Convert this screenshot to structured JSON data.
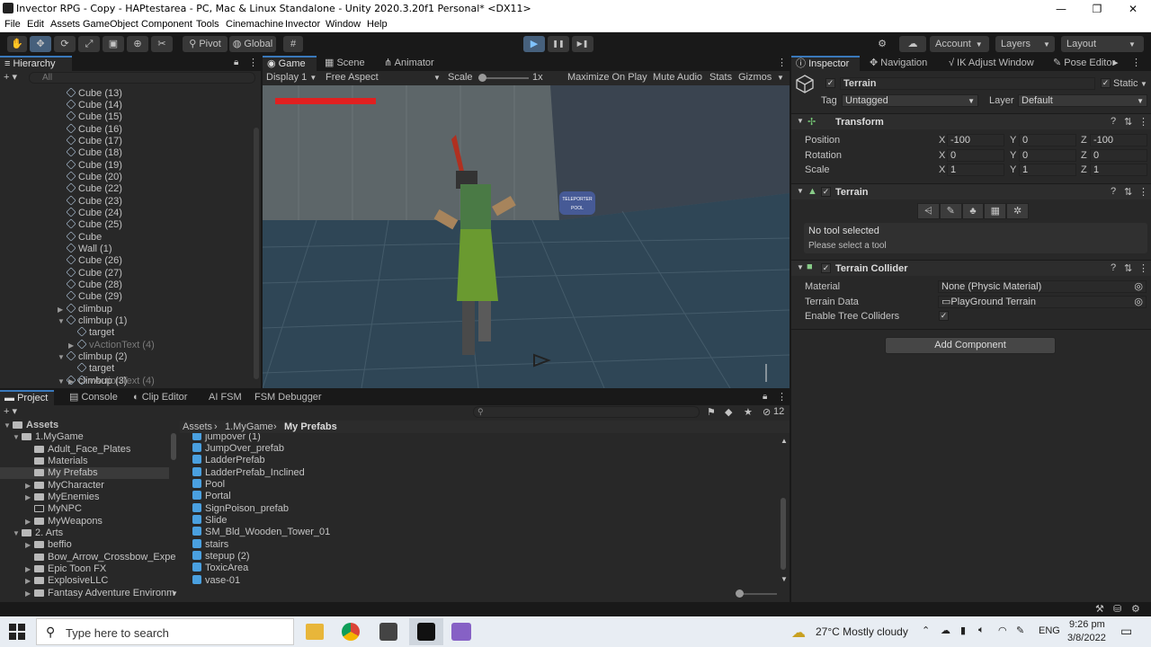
{
  "window": {
    "title": "Invector RPG - Copy - HAPtestarea - PC, Mac & Linux Standalone - Unity 2020.3.20f1 Personal* <DX11>",
    "minimize": "—",
    "maximize": "❐",
    "close": "✕"
  },
  "menu": [
    "File",
    "Edit",
    "Assets",
    "GameObject",
    "Component",
    "Tools",
    "Cinemachine",
    "Invector",
    "Window",
    "Help"
  ],
  "toolbar": {
    "pivot": "Pivot",
    "global": "Global",
    "play": "▶",
    "pause": "❚❚",
    "step": "▶❚",
    "account": "Account",
    "layers": "Layers",
    "layout": "Layout"
  },
  "hierarchy": {
    "tab": "Hierarchy",
    "search_placeholder": "All",
    "items": [
      {
        "label": "Cube (13)"
      },
      {
        "label": "Cube (14)"
      },
      {
        "label": "Cube (15)"
      },
      {
        "label": "Cube (16)"
      },
      {
        "label": "Cube (17)"
      },
      {
        "label": "Cube (18)"
      },
      {
        "label": "Cube (19)"
      },
      {
        "label": "Cube (20)"
      },
      {
        "label": "Cube (22)"
      },
      {
        "label": "Cube (23)"
      },
      {
        "label": "Cube (24)"
      },
      {
        "label": "Cube (25)"
      },
      {
        "label": "Cube"
      },
      {
        "label": "Wall (1)"
      },
      {
        "label": "Cube (26)"
      },
      {
        "label": "Cube (27)"
      },
      {
        "label": "Cube (28)"
      },
      {
        "label": "Cube (29)"
      },
      {
        "label": "climbup"
      },
      {
        "label": "climbup (1)"
      },
      {
        "label": "target"
      },
      {
        "label": "vActionText (4)"
      },
      {
        "label": "climbup (2)"
      },
      {
        "label": "target"
      },
      {
        "label": "vActionText (4)"
      },
      {
        "label": "climbup (3)"
      }
    ]
  },
  "viewport": {
    "tabs": [
      "Game",
      "Scene",
      "Animator"
    ],
    "display": "Display 1",
    "aspect": "Free Aspect",
    "scale_label": "Scale",
    "scale_value": "1x",
    "options": [
      "Maximize On Play",
      "Mute Audio",
      "Stats",
      "Gizmos"
    ],
    "sign_line1": "TELEPORTER",
    "sign_line2": "POOL",
    "health_fraction": 1.0
  },
  "project": {
    "tabs": [
      "Project",
      "Console",
      "Clip Editor",
      "AI FSM",
      "FSM Debugger"
    ],
    "tree": [
      {
        "label": "Assets"
      },
      {
        "label": "1.MyGame"
      },
      {
        "label": "Adult_Face_Plates"
      },
      {
        "label": "Materials"
      },
      {
        "label": "My Prefabs"
      },
      {
        "label": "MyCharacter"
      },
      {
        "label": "MyEnemies"
      },
      {
        "label": "MyNPC"
      },
      {
        "label": "MyWeapons"
      },
      {
        "label": "2. Arts"
      },
      {
        "label": "beffio"
      },
      {
        "label": "Bow_Arrow_Crossbow_Exper"
      },
      {
        "label": "Epic Toon FX"
      },
      {
        "label": "ExplosiveLLC"
      },
      {
        "label": "Fantasy Adventure Environm"
      }
    ],
    "breadcrumb": [
      "Assets",
      "1.MyGame",
      "My Prefabs"
    ],
    "count": "12",
    "files": [
      {
        "label": "jumpover (1)"
      },
      {
        "label": "JumpOver_prefab"
      },
      {
        "label": "LadderPrefab"
      },
      {
        "label": "LadderPrefab_Inclined"
      },
      {
        "label": "Pool"
      },
      {
        "label": "Portal"
      },
      {
        "label": "SignPoison_prefab"
      },
      {
        "label": "Slide"
      },
      {
        "label": "SM_Bld_Wooden_Tower_01"
      },
      {
        "label": "stairs"
      },
      {
        "label": "stepup (2)"
      },
      {
        "label": "ToxicArea"
      },
      {
        "label": "vase-01"
      }
    ]
  },
  "inspector": {
    "tabs": [
      "Inspector",
      "Navigation",
      "IK Adjust Window",
      "Pose Editor"
    ],
    "object_name": "Terrain",
    "static_label": "Static",
    "tag_label": "Tag",
    "tag_value": "Untagged",
    "layer_label": "Layer",
    "layer_value": "Default",
    "transform": {
      "title": "Transform",
      "position_label": "Position",
      "position": [
        "-100",
        "0",
        "-100"
      ],
      "rotation_label": "Rotation",
      "rotation": [
        "0",
        "0",
        "0"
      ],
      "scale_label": "Scale",
      "scale": [
        "1",
        "1",
        "1"
      ]
    },
    "terrain": {
      "title": "Terrain",
      "status": "No tool selected",
      "hint": "Please select a tool"
    },
    "collider": {
      "title": "Terrain Collider",
      "material_label": "Material",
      "material_value": "None (Physic Material)",
      "data_label": "Terrain Data",
      "data_value": "PlayGround Terrain",
      "trees_label": "Enable Tree Colliders"
    },
    "add_component": "Add Component"
  },
  "taskbar": {
    "search_placeholder": "Type here to search",
    "weather": "27°C  Mostly cloudy",
    "lang": "ENG",
    "time": "9:26 pm",
    "date": "3/8/2022"
  }
}
